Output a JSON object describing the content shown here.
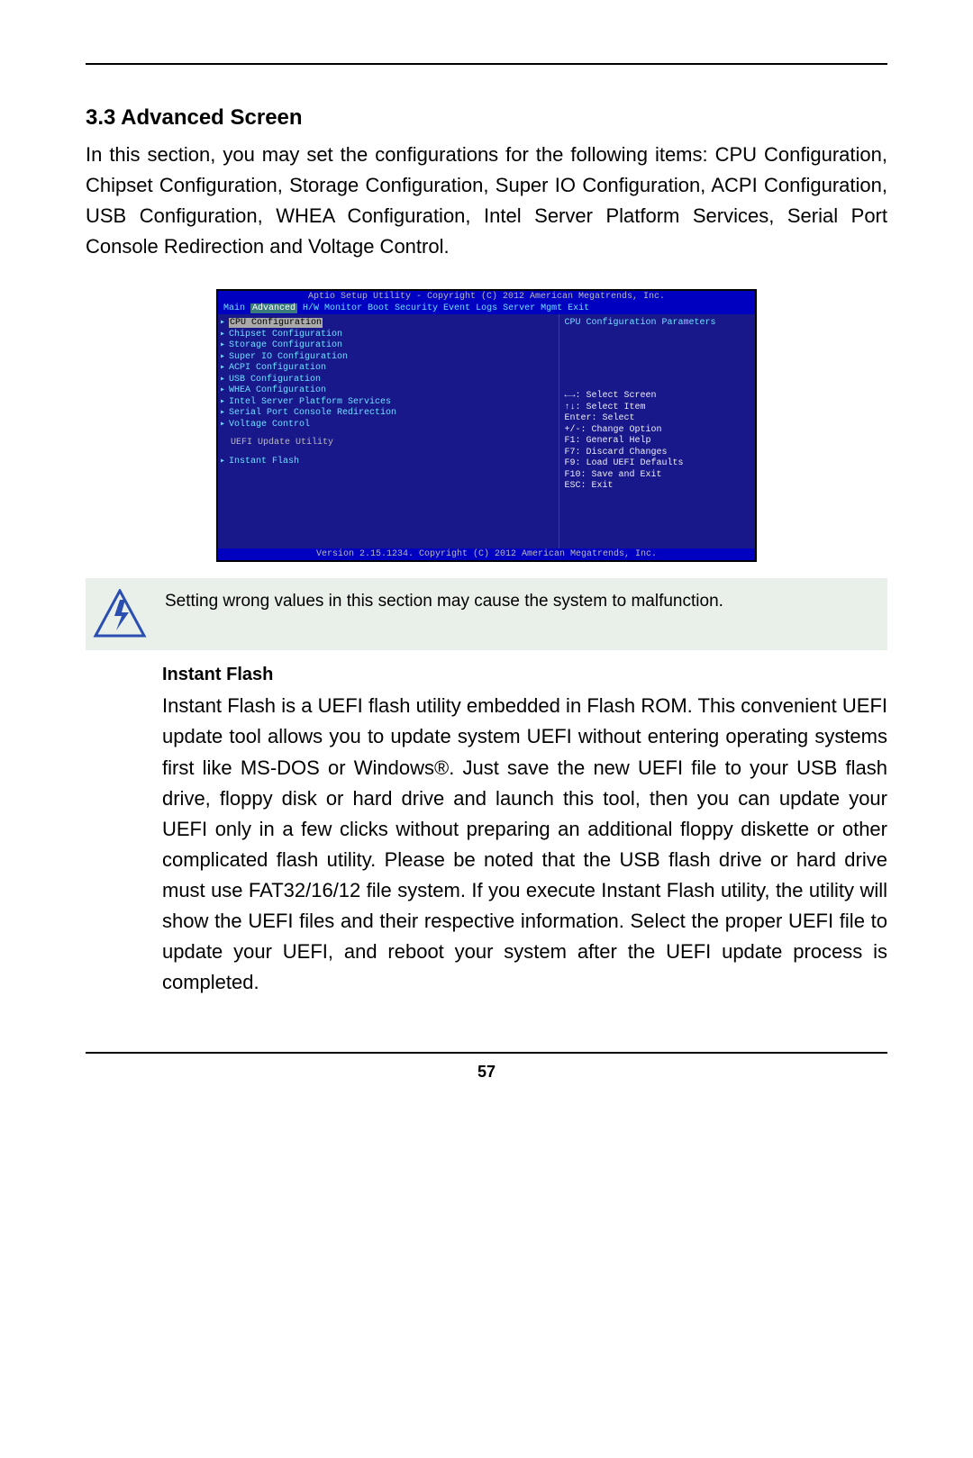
{
  "section": {
    "title": "3.3  Advanced Screen",
    "intro": "In this section, you may set the configurations for the following items: CPU Configuration, Chipset Configuration, Storage Configuration, Super IO Configuration, ACPI Configuration, USB Configuration, WHEA Configuration, Intel Server Platform Services, Serial Port Console Redirection and Voltage Control."
  },
  "bios": {
    "title": "Aptio Setup Utility - Copyright (C) 2012 American Megatrends, Inc.",
    "menubar": {
      "items": [
        "Main",
        "Advanced",
        "H/W Monitor",
        "Boot",
        "Security",
        "Event Logs",
        "Server Mgmt",
        "Exit"
      ],
      "selected_index": 1
    },
    "left_items": [
      {
        "label": "CPU Configuration",
        "arrow": true,
        "selected": true
      },
      {
        "label": "Chipset Configuration",
        "arrow": true
      },
      {
        "label": "Storage Configuration",
        "arrow": true
      },
      {
        "label": "Super IO Configuration",
        "arrow": true
      },
      {
        "label": "ACPI Configuration",
        "arrow": true
      },
      {
        "label": "USB Configuration",
        "arrow": true
      },
      {
        "label": "WHEA Configuration",
        "arrow": true
      },
      {
        "label": "Intel Server Platform Services",
        "arrow": true
      },
      {
        "label": "Serial Port Console Redirection",
        "arrow": true
      },
      {
        "label": "Voltage Control",
        "arrow": true
      }
    ],
    "left_subhead": "UEFI Update Utility",
    "left_extra": {
      "label": "Instant Flash",
      "arrow": true
    },
    "right_title": "CPU Configuration Parameters",
    "help_keys": [
      "←→: Select Screen",
      "↑↓: Select Item",
      "Enter: Select",
      "+/-: Change Option",
      "F1: General Help",
      "F7: Discard Changes",
      "F9: Load UEFI Defaults",
      "F10: Save and Exit",
      "ESC: Exit"
    ],
    "footer": "Version 2.15.1234. Copyright (C) 2012 American Megatrends, Inc."
  },
  "warning": {
    "text": "Setting wrong values in this section may cause  the system to malfunction."
  },
  "subsection": {
    "title": "Instant Flash",
    "body": "Instant Flash is a UEFI flash utility embedded in Flash ROM. This convenient UEFI update tool allows you to update system UEFI without entering operating systems first like MS-DOS or Windows®. Just save the new UEFI file to your USB flash drive, floppy disk or hard drive and launch this tool, then you can update your UEFI only in a few clicks without preparing an additional floppy diskette or other complicated flash utility. Please be noted that the USB flash drive or hard drive must use FAT32/16/12 file system. If you execute Instant Flash utility, the utility will show the UEFI files and their respective information. Select the proper UEFI file to update your UEFI, and reboot your system after the UEFI update process is completed."
  },
  "page_number": "57"
}
